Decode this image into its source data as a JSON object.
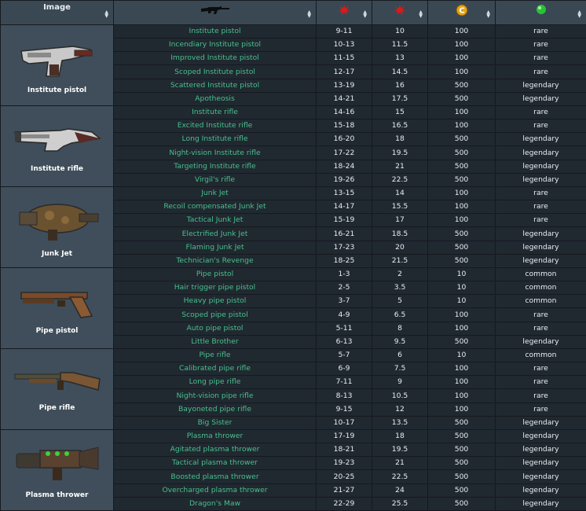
{
  "header": {
    "image_label": "Image",
    "icons": [
      "weapon-rifle-icon",
      "damage-splat-icon",
      "damage-splat-icon",
      "caps-coin-icon",
      "xp-gem-icon"
    ]
  },
  "groups": [
    {
      "name": "Institute pistol",
      "rows": [
        [
          "Institute pistol",
          "9-11",
          "10",
          "100",
          "rare"
        ],
        [
          "Incendiary Institute pistol",
          "10-13",
          "11.5",
          "100",
          "rare"
        ],
        [
          "Improved Institute pistol",
          "11-15",
          "13",
          "100",
          "rare"
        ],
        [
          "Scoped Institute pistol",
          "12-17",
          "14.5",
          "100",
          "rare"
        ],
        [
          "Scattered Institute pistol",
          "13-19",
          "16",
          "500",
          "legendary"
        ],
        [
          "Apotheosis",
          "14-21",
          "17.5",
          "500",
          "legendary"
        ]
      ]
    },
    {
      "name": "Institute rifle",
      "rows": [
        [
          "Institute rifle",
          "14-16",
          "15",
          "100",
          "rare"
        ],
        [
          "Excited Institute rifle",
          "15-18",
          "16.5",
          "100",
          "rare"
        ],
        [
          "Long Institute rifle",
          "16-20",
          "18",
          "500",
          "legendary"
        ],
        [
          "Night-vision Institute rifle",
          "17-22",
          "19.5",
          "500",
          "legendary"
        ],
        [
          "Targeting Institute rifle",
          "18-24",
          "21",
          "500",
          "legendary"
        ],
        [
          "Virgil's rifle",
          "19-26",
          "22.5",
          "500",
          "legendary"
        ]
      ]
    },
    {
      "name": "Junk Jet",
      "rows": [
        [
          "Junk Jet",
          "13-15",
          "14",
          "100",
          "rare"
        ],
        [
          "Recoil compensated Junk Jet",
          "14-17",
          "15.5",
          "100",
          "rare"
        ],
        [
          "Tactical Junk Jet",
          "15-19",
          "17",
          "100",
          "rare"
        ],
        [
          "Electrified Junk Jet",
          "16-21",
          "18.5",
          "500",
          "legendary"
        ],
        [
          "Flaming Junk Jet",
          "17-23",
          "20",
          "500",
          "legendary"
        ],
        [
          "Technician's Revenge",
          "18-25",
          "21.5",
          "500",
          "legendary"
        ]
      ]
    },
    {
      "name": "Pipe pistol",
      "rows": [
        [
          "Pipe pistol",
          "1-3",
          "2",
          "10",
          "common"
        ],
        [
          "Hair trigger pipe pistol",
          "2-5",
          "3.5",
          "10",
          "common"
        ],
        [
          "Heavy pipe pistol",
          "3-7",
          "5",
          "10",
          "common"
        ],
        [
          "Scoped pipe pistol",
          "4-9",
          "6.5",
          "100",
          "rare"
        ],
        [
          "Auto pipe pistol",
          "5-11",
          "8",
          "100",
          "rare"
        ],
        [
          "Little Brother",
          "6-13",
          "9.5",
          "500",
          "legendary"
        ]
      ]
    },
    {
      "name": "Pipe rifle",
      "rows": [
        [
          "Pipe rifle",
          "5-7",
          "6",
          "10",
          "common"
        ],
        [
          "Calibrated pipe rifle",
          "6-9",
          "7.5",
          "100",
          "rare"
        ],
        [
          "Long pipe rifle",
          "7-11",
          "9",
          "100",
          "rare"
        ],
        [
          "Night-vision pipe rifle",
          "8-13",
          "10.5",
          "100",
          "rare"
        ],
        [
          "Bayoneted pipe rifle",
          "9-15",
          "12",
          "100",
          "rare"
        ],
        [
          "Big Sister",
          "10-17",
          "13.5",
          "500",
          "legendary"
        ]
      ]
    },
    {
      "name": "Plasma thrower",
      "rows": [
        [
          "Plasma thrower",
          "17-19",
          "18",
          "500",
          "legendary"
        ],
        [
          "Agitated plasma thrower",
          "18-21",
          "19.5",
          "500",
          "legendary"
        ],
        [
          "Tactical plasma thrower",
          "19-23",
          "21",
          "500",
          "legendary"
        ],
        [
          "Boosted plasma thrower",
          "20-25",
          "22.5",
          "500",
          "legendary"
        ],
        [
          "Overcharged plasma thrower",
          "21-27",
          "24",
          "500",
          "legendary"
        ],
        [
          "Dragon's Maw",
          "22-29",
          "25.5",
          "500",
          "legendary"
        ]
      ]
    }
  ]
}
